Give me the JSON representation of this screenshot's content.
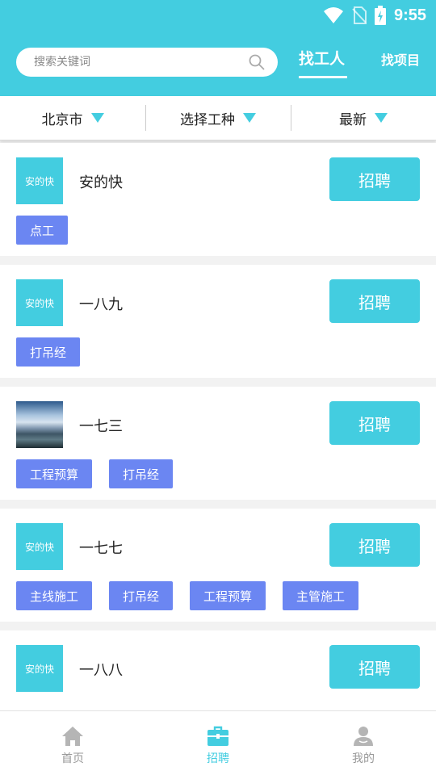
{
  "status_bar": {
    "time": "9:55",
    "icons": [
      "wifi-icon",
      "no-sim-icon",
      "battery-charging-icon"
    ]
  },
  "header": {
    "search": {
      "placeholder": "搜索关键词",
      "value": "",
      "icon": "search-icon"
    },
    "tabs": [
      {
        "label": "找工人",
        "active": true
      },
      {
        "label": "找项目",
        "active": false
      }
    ]
  },
  "filters": [
    {
      "label": "北京市"
    },
    {
      "label": "选择工种"
    },
    {
      "label": "最新"
    }
  ],
  "colors": {
    "accent": "#43cde0",
    "tag": "#6b86f2",
    "inactive": "#999999"
  },
  "workers": [
    {
      "avatar_text": "安的快",
      "name": "安的快",
      "button": "招聘",
      "tags": [
        "点工"
      ]
    },
    {
      "avatar_text": "安的快",
      "name": "一八九",
      "button": "招聘",
      "tags": [
        "打吊经"
      ]
    },
    {
      "avatar_text": "",
      "avatar_type": "photo",
      "name": "一七三",
      "button": "招聘",
      "tags": [
        "工程预算",
        "打吊经"
      ]
    },
    {
      "avatar_text": "安的快",
      "name": "一七七",
      "button": "招聘",
      "tags": [
        "主线施工",
        "打吊经",
        "工程预算",
        "主管施工"
      ]
    },
    {
      "avatar_text": "安的快",
      "name": "一八八",
      "button": "招聘",
      "tags": []
    }
  ],
  "bottom_nav": [
    {
      "label": "首页",
      "icon": "home-icon",
      "active": false
    },
    {
      "label": "招聘",
      "icon": "briefcase-icon",
      "active": true
    },
    {
      "label": "我的",
      "icon": "user-icon",
      "active": false
    }
  ]
}
